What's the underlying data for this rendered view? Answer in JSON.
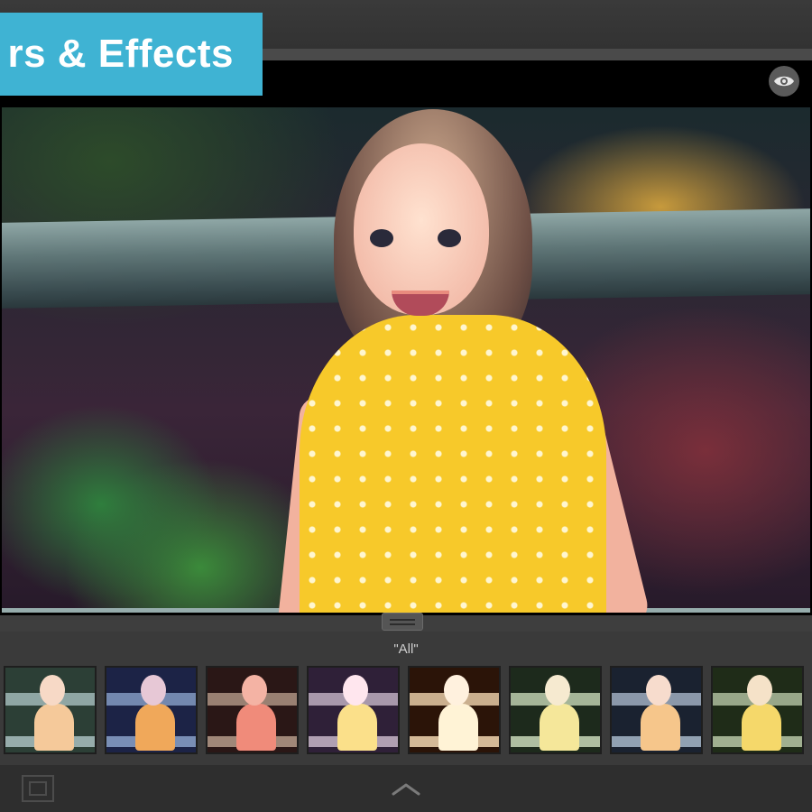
{
  "banner": {
    "title": "rs & Effects"
  },
  "preview": {
    "toggle_icon": "eye-icon"
  },
  "filters": {
    "category": "\"All\"",
    "thumbnails": [
      {
        "bg": "#2c3f36",
        "fence": "#a9c0c0",
        "skin": "#f7d9c6",
        "dress": "#f5c99a"
      },
      {
        "bg": "#1c2346",
        "fence": "#8aa1c9",
        "skin": "#e7c8d6",
        "dress": "#f0a85a"
      },
      {
        "bg": "#2a1716",
        "fence": "#b59b8a",
        "skin": "#f4b3a4",
        "dress": "#f08b7a"
      },
      {
        "bg": "#2f2038",
        "fence": "#c7b6c8",
        "skin": "#ffe6ee",
        "dress": "#fbe08a"
      },
      {
        "bg": "#2b1408",
        "fence": "#f2d6b0",
        "skin": "#fff1de",
        "dress": "#fff3d6"
      },
      {
        "bg": "#1d2a1c",
        "fence": "#c8d8b8",
        "skin": "#f6ead0",
        "dress": "#f5e79a"
      },
      {
        "bg": "#1a2230",
        "fence": "#a7b7c9",
        "skin": "#f7dccd",
        "dress": "#f6c68b"
      },
      {
        "bg": "#1f2c18",
        "fence": "#b7c7a6",
        "skin": "#f5e2c8",
        "dress": "#f5d86a"
      }
    ]
  },
  "toolbar": {
    "crop_icon": "crop-frame-icon",
    "expand_icon": "chevron-up-icon"
  },
  "colors": {
    "banner": "#3fb3d3",
    "chrome": "#3a3a3a"
  }
}
